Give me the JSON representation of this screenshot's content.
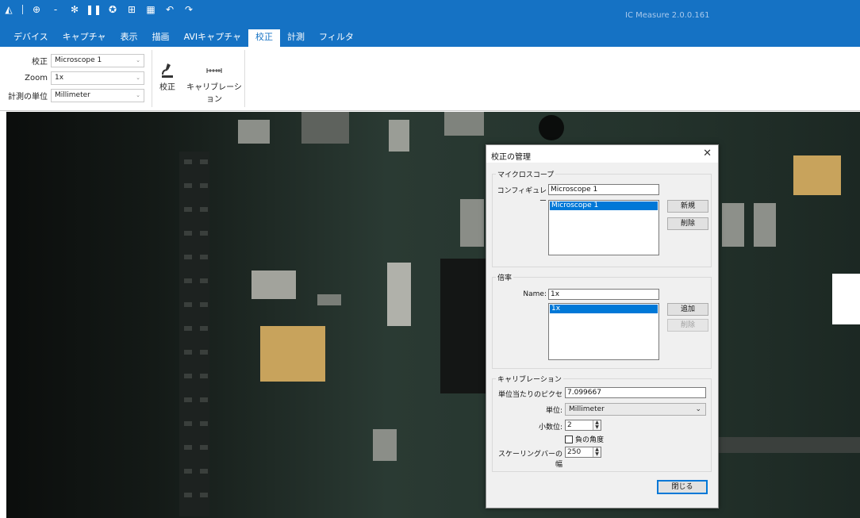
{
  "app": {
    "title": "IC Measure 2.0.0.161"
  },
  "quick_access": [
    {
      "icon": "app-logo-icon",
      "glyph": "◭"
    },
    {
      "icon": "globe-icon",
      "glyph": "⊕"
    },
    {
      "icon": "dropdown-icon",
      "glyph": "-"
    },
    {
      "icon": "settings-sun-icon",
      "glyph": "✻"
    },
    {
      "icon": "pause-icon",
      "glyph": "❚❚"
    },
    {
      "icon": "camera-icon",
      "glyph": "✪"
    },
    {
      "icon": "folder-icon",
      "glyph": "⊞"
    },
    {
      "icon": "image-icon",
      "glyph": "▦"
    },
    {
      "icon": "undo-icon",
      "glyph": "↶"
    },
    {
      "icon": "redo-icon",
      "glyph": "↷"
    }
  ],
  "tabs": [
    {
      "label": "デバイス",
      "active": false
    },
    {
      "label": "キャプチャ",
      "active": false
    },
    {
      "label": "表示",
      "active": false
    },
    {
      "label": "描画",
      "active": false
    },
    {
      "label": "AVIキャプチャ",
      "active": false
    },
    {
      "label": "校正",
      "active": true
    },
    {
      "label": "計測",
      "active": false
    },
    {
      "label": "フィルタ",
      "active": false
    }
  ],
  "ribbon": {
    "calibration_label": "校正",
    "calibration_value": "Microscope 1",
    "zoom_label": "Zoom",
    "zoom_value": "1x",
    "unit_label": "計測の単位",
    "unit_value": "Millimeter",
    "btn_calibrate": "校正",
    "btn_calibration": "キャリブレーション"
  },
  "dialog": {
    "title": "校正の管理",
    "close": "✕",
    "microscope": {
      "group_title": "マイクロスコープ",
      "config_label": "コンフィギュレー",
      "config_value": "Microscope 1",
      "list_item": "Microscope 1",
      "new_button": "新規",
      "delete_button": "削除"
    },
    "magnification": {
      "group_title": "倍率",
      "name_label": "Name:",
      "name_value": "1x",
      "list_item": "1x",
      "add_button": "追加",
      "delete_button": "削除"
    },
    "calibration": {
      "group_title": "キャリブレーション",
      "pixels_label": "単位当たりのピクセ",
      "pixels_value": "7.099667",
      "unit_label": "単位:",
      "unit_value": "Millimeter",
      "decimals_label": "小数位:",
      "decimals_value": "2",
      "negative_angle_label": "負の角度",
      "scalebar_label": "スケーリングバーの幅",
      "scalebar_value": "250"
    },
    "close_button": "閉じる"
  },
  "colors": {
    "accent": "#1572c4",
    "selection": "#0078d7"
  }
}
